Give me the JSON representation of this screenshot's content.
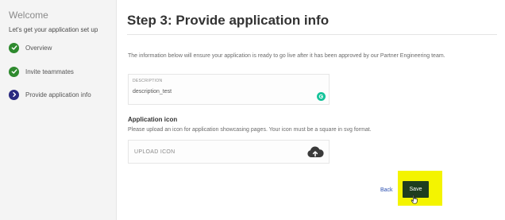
{
  "sidebar": {
    "title": "Welcome",
    "subtitle": "Let's get your application set up",
    "steps": [
      {
        "label": "Overview",
        "status": "done",
        "icon": "check-icon"
      },
      {
        "label": "Invite teammates",
        "status": "done",
        "icon": "check-icon"
      },
      {
        "label": "Provide application info",
        "status": "current",
        "icon": "chevron-right-icon"
      }
    ]
  },
  "main": {
    "title": "Step 3: Provide application info",
    "intro": "The information below will ensure your application is ready to go live after it has been approved by our Partner Engineering team.",
    "description": {
      "label": "DESCRIPTION",
      "value": "description_test",
      "assist_icon": "grammarly-icon"
    },
    "application_icon": {
      "title": "Application icon",
      "help": "Please upload an icon for application showcasing pages. Your icon must be a square in svg format.",
      "upload_label": "UPLOAD ICON",
      "upload_icon": "cloud-upload-icon"
    },
    "actions": {
      "back_label": "Back",
      "save_label": "Save"
    }
  },
  "colors": {
    "done": "#2e8a2e",
    "current": "#2a2a80",
    "save_bg": "#1f3d1f",
    "highlight": "#f4f400",
    "link": "#2a4fb0"
  }
}
